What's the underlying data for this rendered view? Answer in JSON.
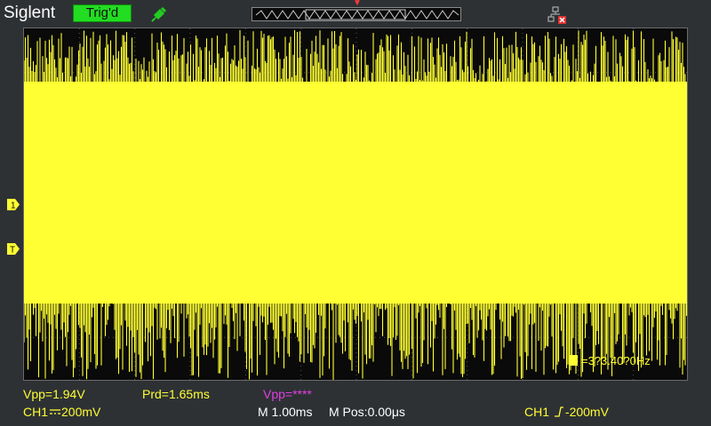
{
  "top_bar": {
    "brand": "Siglent",
    "trigger_status": "Trig'd",
    "probe_icon": "probe-icon",
    "usb_icon": "usb-disconnected-icon"
  },
  "screen": {
    "ch1_marker": "1",
    "trigger_level_marker": "T",
    "frequency_label": "=3?3.40?0Hz"
  },
  "measurements": {
    "vpp_ch1": "Vpp=1.94V",
    "period": "Prd=1.65ms",
    "vpp_ch2": "Vpp=****"
  },
  "status": {
    "ch1_scale": "CH1",
    "ch1_volts": "200mV",
    "timebase": "M 1.00ms",
    "mpos": "M Pos:0.00μs",
    "trigger": "CH1",
    "trigger_level": "-200mV"
  },
  "colors": {
    "channel1": "#ffff33",
    "channel2": "#e040e0",
    "trig_ok": "#22dd22",
    "background": "#2e3134"
  }
}
